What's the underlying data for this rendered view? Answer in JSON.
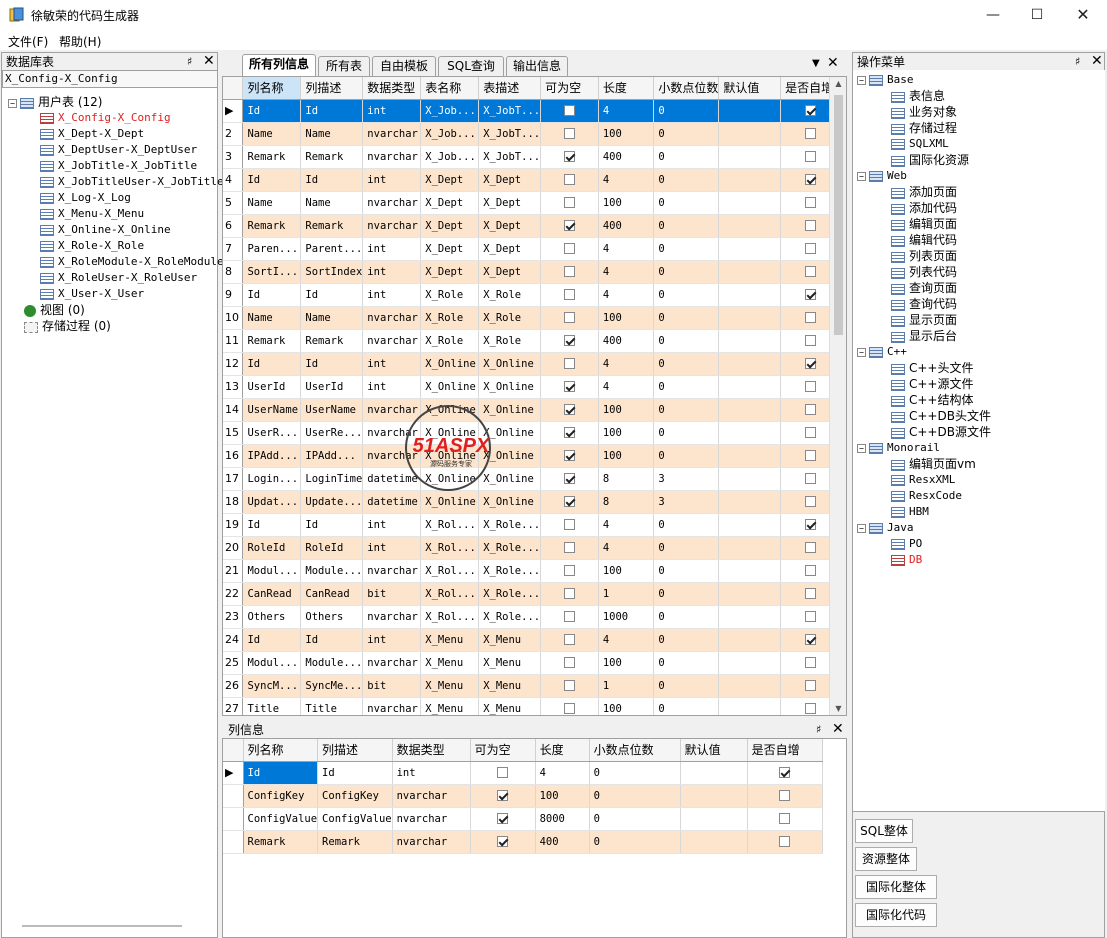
{
  "window": {
    "title": "徐敏荣的代码生成器"
  },
  "menu": [
    "文件(F)",
    "帮助(H)"
  ],
  "db_panel": {
    "title": "数据库表",
    "selected": "X_Config-X_Config",
    "root": "用户表 (12)",
    "tables": [
      "X_Config-X_Config",
      "X_Dept-X_Dept",
      "X_DeptUser-X_DeptUser",
      "X_JobTitle-X_JobTitle",
      "X_JobTitleUser-X_JobTitleU",
      "X_Log-X_Log",
      "X_Menu-X_Menu",
      "X_Online-X_Online",
      "X_Role-X_Role",
      "X_RoleModule-X_RoleModule",
      "X_RoleUser-X_RoleUser",
      "X_User-X_User"
    ],
    "views": "视图 (0)",
    "procs": "存储过程 (0)"
  },
  "tabs": [
    "所有列信息",
    "所有表",
    "自由模板",
    "SQL查询",
    "输出信息"
  ],
  "grid": {
    "headers": [
      "列名称",
      "列描述",
      "数据类型",
      "表名称",
      "表描述",
      "可为空",
      "长度",
      "小数点位数",
      "默认值",
      "是否自增"
    ],
    "rows": [
      [
        "1",
        "Id",
        "Id",
        "int",
        "X_Job...",
        "X_JobT...",
        false,
        "4",
        "0",
        "",
        true
      ],
      [
        "2",
        "Name",
        "Name",
        "nvarchar",
        "X_Job...",
        "X_JobT...",
        false,
        "100",
        "0",
        "",
        false
      ],
      [
        "3",
        "Remark",
        "Remark",
        "nvarchar",
        "X_Job...",
        "X_JobT...",
        true,
        "400",
        "0",
        "",
        false
      ],
      [
        "4",
        "Id",
        "Id",
        "int",
        "X_Dept",
        "X_Dept",
        false,
        "4",
        "0",
        "",
        true
      ],
      [
        "5",
        "Name",
        "Name",
        "nvarchar",
        "X_Dept",
        "X_Dept",
        false,
        "100",
        "0",
        "",
        false
      ],
      [
        "6",
        "Remark",
        "Remark",
        "nvarchar",
        "X_Dept",
        "X_Dept",
        true,
        "400",
        "0",
        "",
        false
      ],
      [
        "7",
        "Paren...",
        "Parent...",
        "int",
        "X_Dept",
        "X_Dept",
        false,
        "4",
        "0",
        "",
        false
      ],
      [
        "8",
        "SortI...",
        "SortIndex",
        "int",
        "X_Dept",
        "X_Dept",
        false,
        "4",
        "0",
        "",
        false
      ],
      [
        "9",
        "Id",
        "Id",
        "int",
        "X_Role",
        "X_Role",
        false,
        "4",
        "0",
        "",
        true
      ],
      [
        "10",
        "Name",
        "Name",
        "nvarchar",
        "X_Role",
        "X_Role",
        false,
        "100",
        "0",
        "",
        false
      ],
      [
        "11",
        "Remark",
        "Remark",
        "nvarchar",
        "X_Role",
        "X_Role",
        true,
        "400",
        "0",
        "",
        false
      ],
      [
        "12",
        "Id",
        "Id",
        "int",
        "X_Online",
        "X_Online",
        false,
        "4",
        "0",
        "",
        true
      ],
      [
        "13",
        "UserId",
        "UserId",
        "int",
        "X_Online",
        "X_Online",
        true,
        "4",
        "0",
        "",
        false
      ],
      [
        "14",
        "UserName",
        "UserName",
        "nvarchar",
        "X_Online",
        "X_Online",
        true,
        "100",
        "0",
        "",
        false
      ],
      [
        "15",
        "UserR...",
        "UserRe...",
        "nvarchar",
        "X_Online",
        "X_Online",
        true,
        "100",
        "0",
        "",
        false
      ],
      [
        "16",
        "IPAdd...",
        "IPAdd...",
        "nvarchar",
        "X_Online",
        "X_Online",
        true,
        "100",
        "0",
        "",
        false
      ],
      [
        "17",
        "Login...",
        "LoginTime",
        "datetime",
        "X_Online",
        "X_Online",
        true,
        "8",
        "3",
        "",
        false
      ],
      [
        "18",
        "Updat...",
        "Update...",
        "datetime",
        "X_Online",
        "X_Online",
        true,
        "8",
        "3",
        "",
        false
      ],
      [
        "19",
        "Id",
        "Id",
        "int",
        "X_Rol...",
        "X_Role...",
        false,
        "4",
        "0",
        "",
        true
      ],
      [
        "20",
        "RoleId",
        "RoleId",
        "int",
        "X_Rol...",
        "X_Role...",
        false,
        "4",
        "0",
        "",
        false
      ],
      [
        "21",
        "Modul...",
        "Module...",
        "nvarchar",
        "X_Rol...",
        "X_Role...",
        false,
        "100",
        "0",
        "",
        false
      ],
      [
        "22",
        "CanRead",
        "CanRead",
        "bit",
        "X_Rol...",
        "X_Role...",
        false,
        "1",
        "0",
        "",
        false
      ],
      [
        "23",
        "Others",
        "Others",
        "nvarchar",
        "X_Rol...",
        "X_Role...",
        false,
        "1000",
        "0",
        "",
        false
      ],
      [
        "24",
        "Id",
        "Id",
        "int",
        "X_Menu",
        "X_Menu",
        false,
        "4",
        "0",
        "",
        true
      ],
      [
        "25",
        "Modul...",
        "Module...",
        "nvarchar",
        "X_Menu",
        "X_Menu",
        false,
        "100",
        "0",
        "",
        false
      ],
      [
        "26",
        "SyncM...",
        "SyncMe...",
        "bit",
        "X_Menu",
        "X_Menu",
        false,
        "1",
        "0",
        "",
        false
      ],
      [
        "27",
        "Title",
        "Title",
        "nvarchar",
        "X_Menu",
        "X_Menu",
        false,
        "100",
        "0",
        "",
        false
      ]
    ]
  },
  "col_panel": {
    "title": "列信息",
    "headers": [
      "列名称",
      "列描述",
      "数据类型",
      "可为空",
      "长度",
      "小数点位数",
      "默认值",
      "是否自增"
    ],
    "rows": [
      [
        "Id",
        "Id",
        "int",
        false,
        "4",
        "0",
        "",
        true
      ],
      [
        "ConfigKey",
        "ConfigKey",
        "nvarchar",
        true,
        "100",
        "0",
        "",
        false
      ],
      [
        "ConfigValue",
        "ConfigValue",
        "nvarchar",
        true,
        "8000",
        "0",
        "",
        false
      ],
      [
        "Remark",
        "Remark",
        "nvarchar",
        true,
        "400",
        "0",
        "",
        false
      ]
    ]
  },
  "ops_panel": {
    "title": "操作菜单",
    "groups": [
      {
        "name": "Base",
        "items": [
          "表信息",
          "业务对象",
          "存储过程",
          "SQLXML",
          "国际化资源"
        ]
      },
      {
        "name": "Web",
        "items": [
          "添加页面",
          "添加代码",
          "编辑页面",
          "编辑代码",
          "列表页面",
          "列表代码",
          "查询页面",
          "查询代码",
          "显示页面",
          "显示后台"
        ]
      },
      {
        "name": "C++",
        "items": [
          "C++头文件",
          "C++源文件",
          "C++结构体",
          "C++DB头文件",
          "C++DB源文件"
        ]
      },
      {
        "name": "Monorail",
        "items": [
          "编辑页面vm",
          "ResxXML",
          "ResxCode",
          "HBM"
        ]
      },
      {
        "name": "Java",
        "items": [
          "PO",
          "DB"
        ]
      }
    ],
    "buttons": [
      "SQL整体",
      "资源整体",
      "国际化整体",
      "国际化代码"
    ]
  },
  "watermark": {
    "text": "51ASPX",
    "sub": "源码服务专家"
  },
  "colors": {
    "selection": "#0078d7",
    "alt_row": "#fde4cc",
    "red_text": "#e02020"
  }
}
